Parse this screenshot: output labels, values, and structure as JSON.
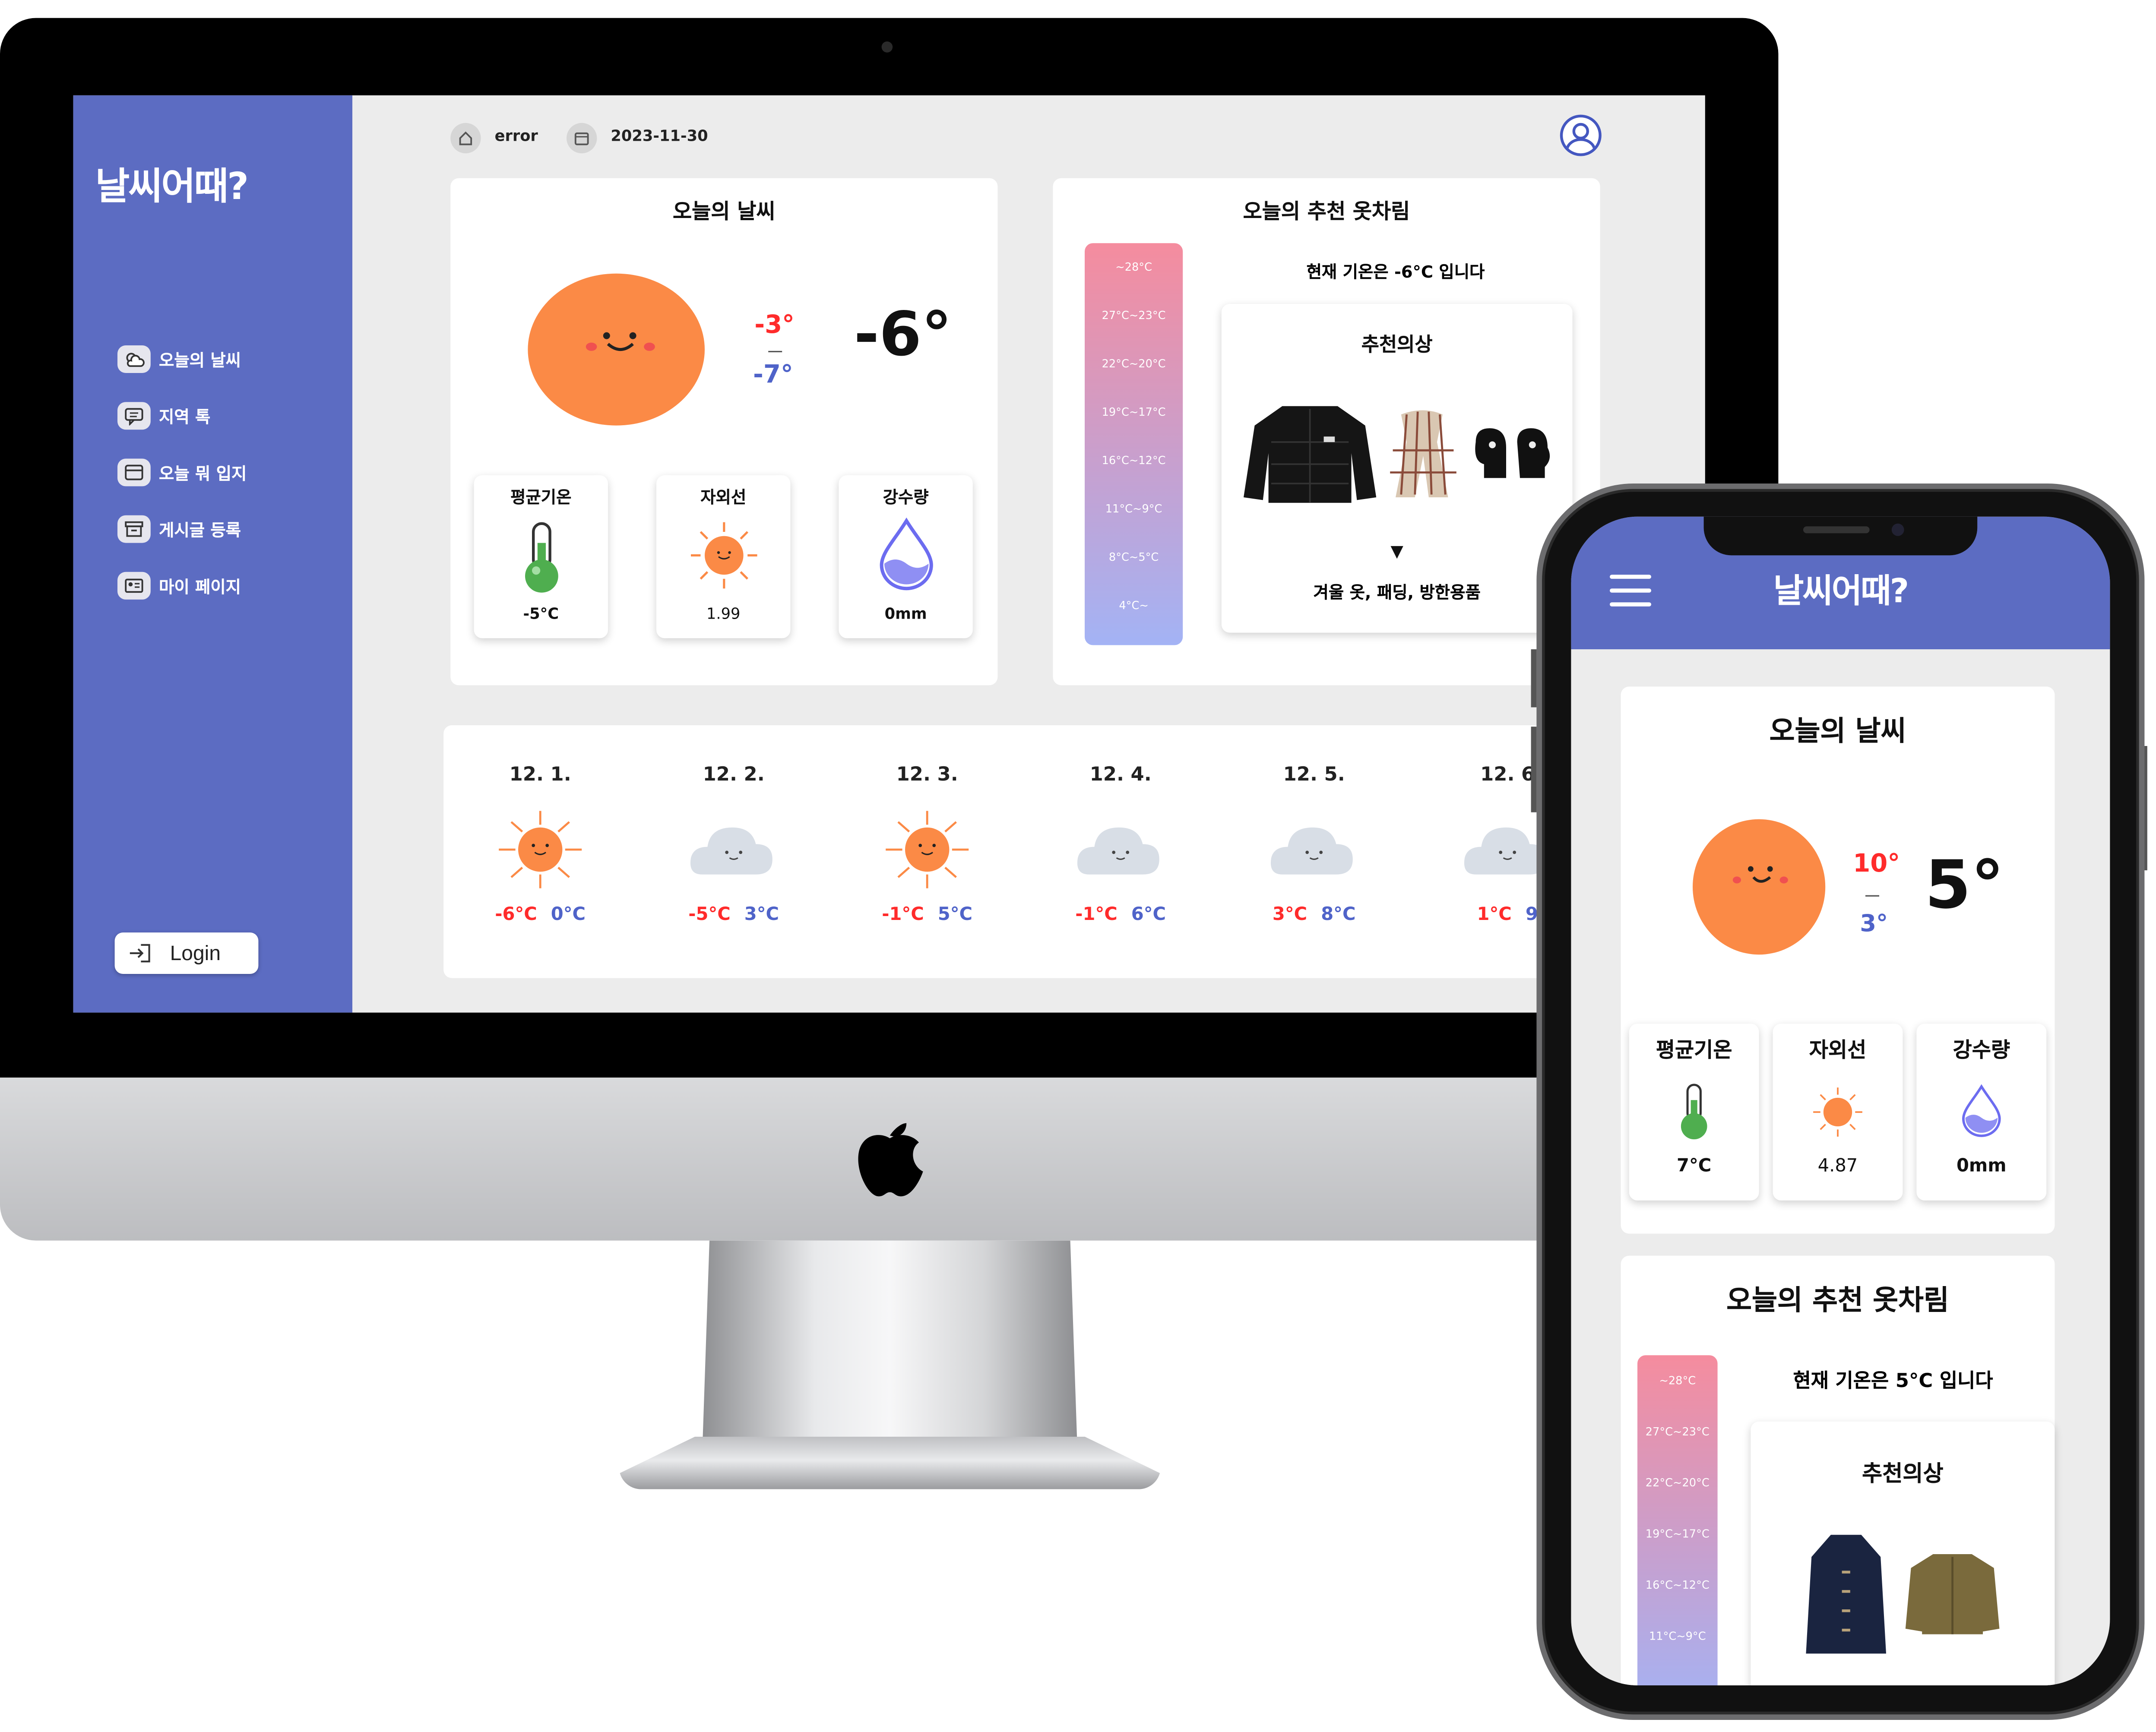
{
  "desktop": {
    "sidebar": {
      "logo": "날씨어때?",
      "items": [
        {
          "label": "오늘의 날씨"
        },
        {
          "label": "지역 톡"
        },
        {
          "label": "오늘 뭐 입지"
        },
        {
          "label": "게시글 등록"
        },
        {
          "label": "마이 페이지"
        }
      ],
      "login_label": "Login"
    },
    "topbar": {
      "location": "error",
      "date": "2023-11-30"
    },
    "today": {
      "title": "오늘의 날씨",
      "high": "-3°",
      "low": "-7°",
      "current": "-6°",
      "stats": [
        {
          "label": "평균기온",
          "value": "-5°C"
        },
        {
          "label": "자외선",
          "value": "1.99"
        },
        {
          "label": "강수량",
          "value": "0mm"
        }
      ]
    },
    "outfit": {
      "title": "오늘의 추천 옷차림",
      "scale": [
        "~28°C",
        "27°C~23°C",
        "22°C~20°C",
        "19°C~17°C",
        "16°C~12°C",
        "11°C~9°C",
        "8°C~5°C",
        "4°C~"
      ],
      "current_text": "현재 기온은 -6°C 입니다",
      "rec_title": "추천의상",
      "arrow": "▼",
      "rec_items": "겨울 옷, 패딩, 방한용품"
    },
    "forecast": [
      {
        "date": "12. 1.",
        "icon": "sun-icon",
        "low": "-6°C",
        "high": "0°C"
      },
      {
        "date": "12. 2.",
        "icon": "cloud-icon",
        "low": "-5°C",
        "high": "3°C"
      },
      {
        "date": "12. 3.",
        "icon": "sun-icon",
        "low": "-1°C",
        "high": "5°C"
      },
      {
        "date": "12. 4.",
        "icon": "cloud-icon",
        "low": "-1°C",
        "high": "6°C"
      },
      {
        "date": "12. 5.",
        "icon": "cloud-icon",
        "low": "3°C",
        "high": "8°C"
      },
      {
        "date": "12. 6",
        "icon": "cloud-icon",
        "low": "1°C",
        "high": "9"
      }
    ]
  },
  "mobile": {
    "logo": "날씨어때?",
    "today": {
      "title": "오늘의 날씨",
      "high": "10°",
      "low": "3°",
      "current": "5°",
      "stats": [
        {
          "label": "평균기온",
          "value": "7°C"
        },
        {
          "label": "자외선",
          "value": "4.87"
        },
        {
          "label": "강수량",
          "value": "0mm"
        }
      ]
    },
    "outfit": {
      "title": "오늘의 추천 옷차림",
      "scale": [
        "~28°C",
        "27°C~23°C",
        "22°C~20°C",
        "19°C~17°C",
        "16°C~12°C",
        "11°C~9°C"
      ],
      "current_text": "현재 기온은 5°C 입니다",
      "rec_title": "추천의상"
    }
  },
  "colors": {
    "brand": "#5c6cc2",
    "sun": "#fb8a46",
    "high_temp": "#ff2b2b",
    "low_temp": "#4f63c9"
  }
}
